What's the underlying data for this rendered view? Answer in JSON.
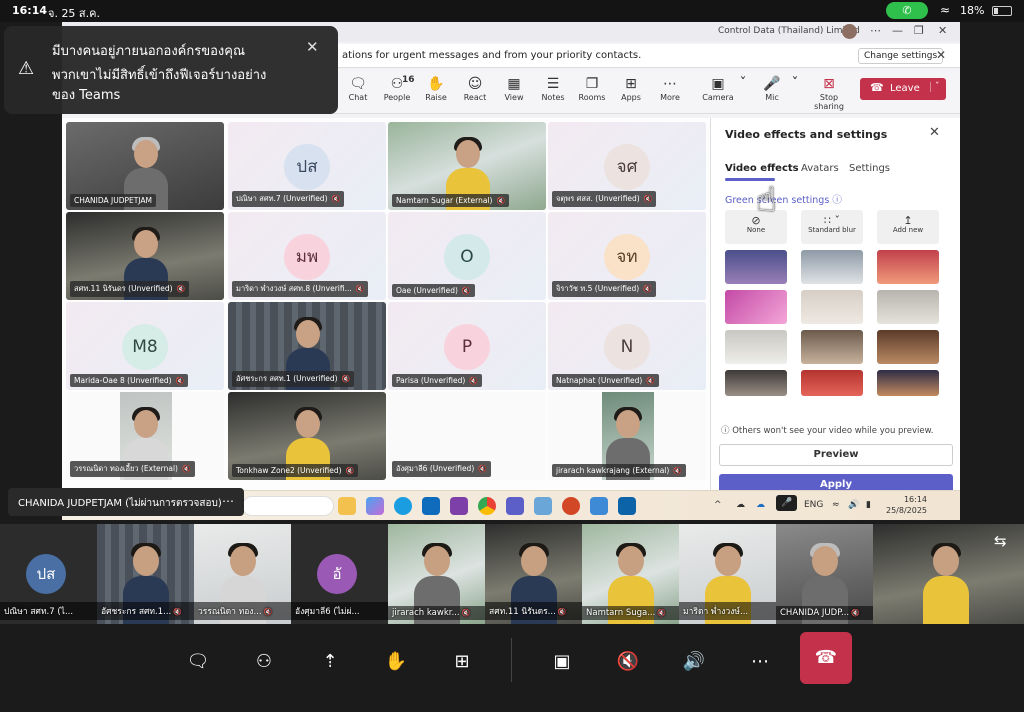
{
  "status_bar": {
    "time": "16:14",
    "date": "จ. 25 ส.ค.",
    "battery": "18%"
  },
  "toast": {
    "line1": "มีบางคนอยู่ภายนอกองค์กรของคุณ",
    "line2": "พวกเขาไม่มีสิทธิ์เข้าถึงฟีเจอร์บางอย่าง",
    "line3": "ของ Teams"
  },
  "shared_screen": {
    "titlebar_org": "Control Data (Thailand) Limited",
    "notice_text": "ations for urgent messages and from your priority contacts.",
    "notice_button": "Change settings",
    "toolbar": {
      "chat": "Chat",
      "people": "People",
      "people_count": "16",
      "raise": "Raise",
      "react": "React",
      "view": "View",
      "notes": "Notes",
      "rooms": "Rooms",
      "apps": "Apps",
      "more": "More",
      "camera": "Camera",
      "mic": "Mic",
      "stop_sharing": "Stop sharing",
      "leave": "Leave"
    },
    "participants": [
      {
        "name": "CHANIDA JUDPETJAM"
      },
      {
        "name": "ปณิษา สศท.7 (Unverified)",
        "initials": "ปส"
      },
      {
        "name": "Namtarn Sugar (External)"
      },
      {
        "name": "จตุพร ศสส. (Unverified)",
        "initials": "จศ"
      },
      {
        "name": "สศท.11 นิรันดร (Unverified)"
      },
      {
        "name": "มาริดา พ่ำงวงษ์ สศท.8 (Unverifi...",
        "initials": "มพ"
      },
      {
        "name": "Oae (Unverified)",
        "initials": "O"
      },
      {
        "name": "จิราวัช ท.5 (Unverified)",
        "initials": "จท"
      },
      {
        "name": "Marida-Oae 8 (Unverified)",
        "initials": "M8"
      },
      {
        "name": "อัศชระกร สศท.1 (Unverified)"
      },
      {
        "name": "Parisa (Unverified)",
        "initials": "P"
      },
      {
        "name": "Natnaphat (Unverified)",
        "initials": "N"
      },
      {
        "name": "วรรณนิดา ทองเอี้ยว (External)"
      },
      {
        "name": "Tonkhaw Zone2 (Unverified)"
      },
      {
        "name": "อังศุมาลี6 (Unverified)"
      },
      {
        "name": "jirarach kawkrajang (External)"
      }
    ],
    "panel": {
      "title": "Video effects and settings",
      "tabs": [
        "Video effects",
        "Avatars",
        "Settings"
      ],
      "green_screen": "Green screen settings",
      "effects": [
        "None",
        "Standard blur",
        "Add new"
      ],
      "info": "Others won't see your video while you preview.",
      "preview": "Preview",
      "apply": "Apply"
    },
    "taskbar": {
      "lang": "ENG",
      "clock_time": "16:14",
      "clock_date": "25/8/2025"
    }
  },
  "sharer_label": "CHANIDA JUDPETJAM (ไม่ผ่านการตรวจสอบ)",
  "strip": [
    {
      "name": "ปณิษา สศท.7 (ไ...",
      "initials": "ปส"
    },
    {
      "name": "อัศชระกร สศท.1..."
    },
    {
      "name": "วรรณนิดา ทอง..."
    },
    {
      "name": "อังศุมาลี6 (ไม่ผ่...",
      "initials": "อั"
    },
    {
      "name": "jirarach kawkr..."
    },
    {
      "name": "สศท.11 นิรันดร..."
    },
    {
      "name": "Namtarn Suga..."
    },
    {
      "name": "มาริดา พ่ำงวงษ์..."
    },
    {
      "name": "CHANIDA JUDP..."
    },
    {
      "name": ""
    }
  ],
  "colors": {
    "teams_purple": "#5b5fc7",
    "leave_red": "#c4314b",
    "call_green": "#2fbf4b"
  }
}
